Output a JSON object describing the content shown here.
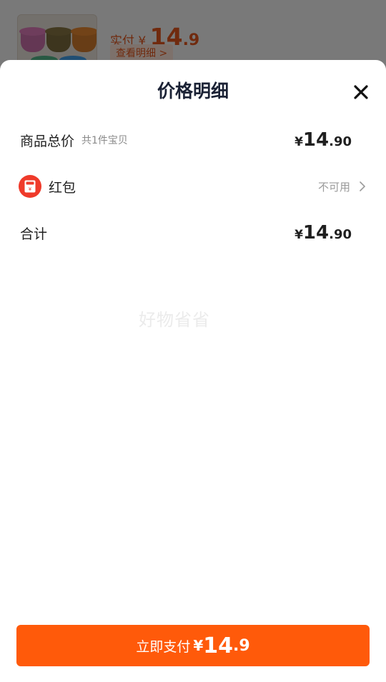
{
  "background": {
    "price_label": "实付",
    "currency": "¥",
    "price_int": "14",
    "price_dec": ".9",
    "detail_button": "查看明细 >"
  },
  "sheet": {
    "title": "价格明细",
    "close_icon": "close-icon",
    "rows": {
      "goods_total": {
        "label": "商品总价",
        "sub": "共1件宝贝",
        "currency": "¥",
        "int": "14",
        "dec": ".90"
      },
      "red_packet": {
        "icon": "red-packet-icon",
        "label": "红包",
        "status": "不可用"
      },
      "total": {
        "label": "合计",
        "currency": "¥",
        "int": "14",
        "dec": ".90"
      }
    },
    "watermark": "好物省省",
    "pay_button": {
      "label": "立即支付",
      "currency": "¥",
      "int": "14",
      "dec": ".9"
    }
  },
  "colors": {
    "accent": "#ff5a0a",
    "red_packet": "#ef3a2a",
    "title": "#1b2235"
  }
}
